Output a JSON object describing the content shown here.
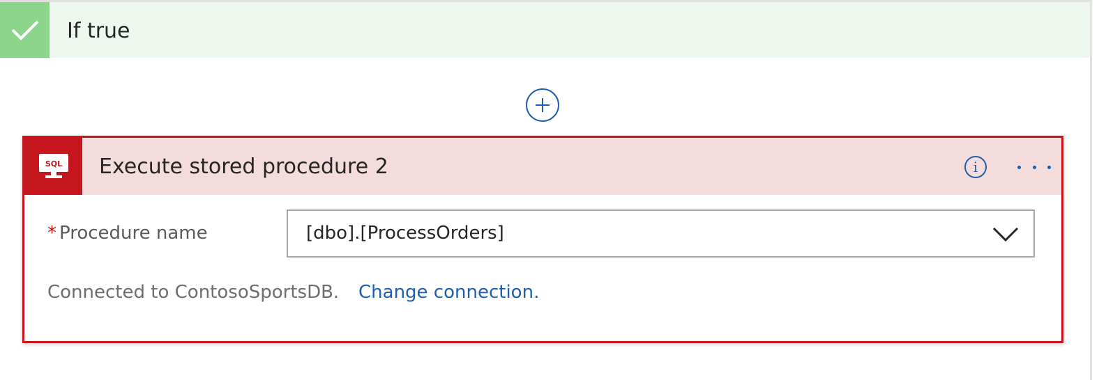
{
  "branch": {
    "title": "If true",
    "icon": "checkmark-icon",
    "header_color": "#edf7ee",
    "icon_bg_color": "#8ed58c"
  },
  "add_step": {
    "icon": "plus-circle-icon"
  },
  "action": {
    "title": "Execute stored procedure 2",
    "icon": "sql-server-icon",
    "icon_text": "SQL",
    "accent_color": "#c4161c",
    "header_color": "#f4dcdd",
    "info_icon": "info-icon",
    "info_glyph": "i",
    "more_icon": "more-options-icon"
  },
  "procedure_field": {
    "required_marker": "*",
    "label": "Procedure name",
    "value": "[dbo].[ProcessOrders]",
    "dropdown_icon": "chevron-down-icon"
  },
  "connection": {
    "text": "Connected to ContosoSportsDB.",
    "link": "Change connection.",
    "link_color": "#1f5fad"
  }
}
